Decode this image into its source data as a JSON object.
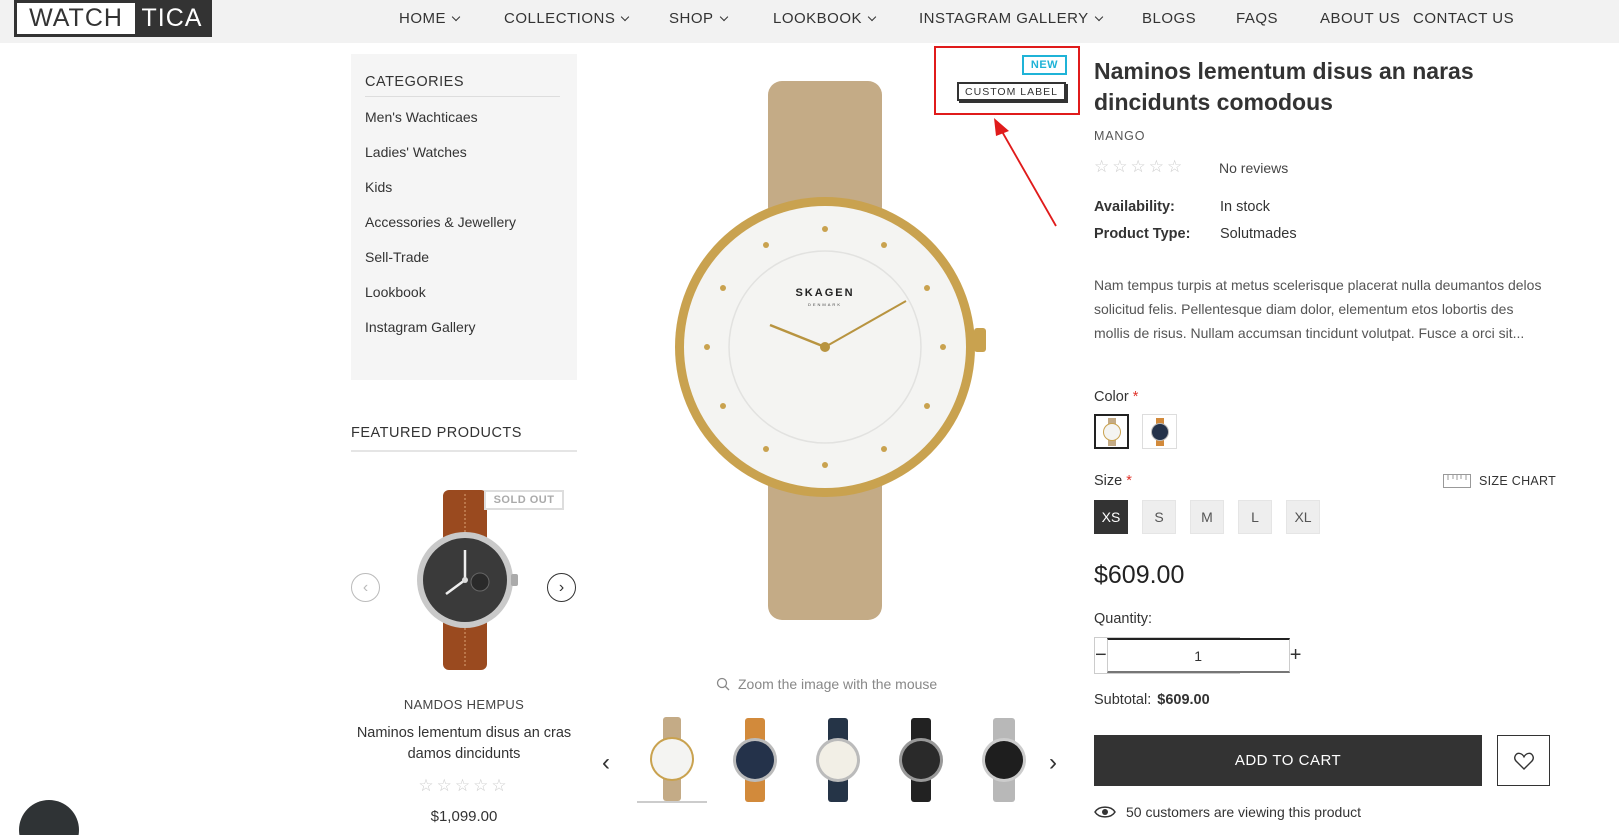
{
  "header": {
    "logo_left": "WATCH",
    "logo_right": "TICA",
    "nav": [
      {
        "label": "HOME",
        "dropdown": true
      },
      {
        "label": "COLLECTIONS",
        "dropdown": true
      },
      {
        "label": "SHOP",
        "dropdown": true
      },
      {
        "label": "LOOKBOOK",
        "dropdown": true
      },
      {
        "label": "INSTAGRAM GALLERY",
        "dropdown": true
      },
      {
        "label": "BLOGS",
        "dropdown": false
      },
      {
        "label": "FAQS",
        "dropdown": false
      },
      {
        "label": "ABOUT US",
        "dropdown": false
      },
      {
        "label": "CONTACT US",
        "dropdown": false
      }
    ]
  },
  "sidebar": {
    "categories_title": "CATEGORIES",
    "categories": [
      "Men's Wachticaes",
      "Ladies' Watches",
      "Kids",
      "Accessories & Jewellery",
      "Sell-Trade",
      "Lookbook",
      "Instagram Gallery"
    ],
    "featured_title": "FEATURED PRODUCTS",
    "featured": {
      "badge": "SOLD OUT",
      "vendor": "NAMDOS HEMPUS",
      "name": "Naminos lementum disus an cras damos dincidunts",
      "stars": "☆☆☆☆☆",
      "price": "$1,099.00"
    }
  },
  "gallery": {
    "label_new": "NEW",
    "label_custom": "CUSTOM LABEL",
    "zoom_hint": "Zoom the image with the mouse",
    "prev_icon": "chevron-left-icon",
    "next_icon": "chevron-right-icon"
  },
  "product": {
    "title": "Naminos lementum disus an naras dincidunts comodous",
    "vendor": "MANGO",
    "stars": "☆☆☆☆☆",
    "reviews": "No reviews",
    "availability_label": "Availability:",
    "availability": "In stock",
    "type_label": "Product Type:",
    "type": "Solutmades",
    "description": "Nam tempus turpis at metus scelerisque placerat nulla deumantos delos solicitud felis. Pellentesque diam dolor, elementum etos lobortis des mollis de risus. Nullam accumsan tincidunt volutpat. Fusce a orci sit...",
    "color_label": "Color",
    "required_mark": "*",
    "size_label": "Size",
    "size_chart": "SIZE CHART",
    "sizes": [
      "XS",
      "S",
      "M",
      "L",
      "XL"
    ],
    "selected_size": "XS",
    "price": "$609.00",
    "quantity_label": "Quantity:",
    "quantity": "1",
    "subtotal_label": "Subtotal:",
    "subtotal": "$609.00",
    "add_to_cart": "ADD TO CART",
    "viewing": "50 customers are viewing this product"
  },
  "colors": {
    "dark": "#333333",
    "highlight_red": "#e01b1b",
    "new_label": "#1fb3d7",
    "required": "#e0332a",
    "header_bg": "#f2f2f2"
  }
}
